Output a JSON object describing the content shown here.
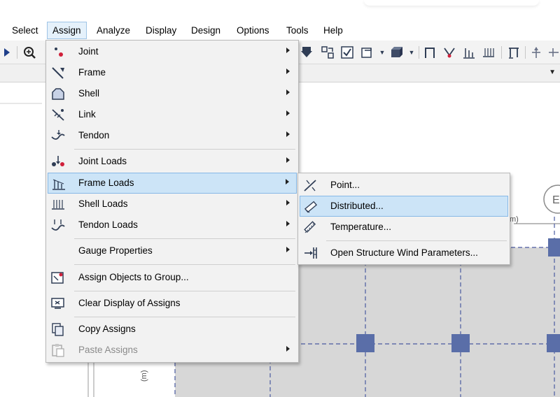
{
  "menubar": {
    "items": [
      "Select",
      "Assign",
      "Analyze",
      "Display",
      "Design",
      "Options",
      "Tools",
      "Help"
    ],
    "active": "Assign"
  },
  "assign_menu": {
    "items": [
      {
        "label": "Joint",
        "icon": "joint-icon",
        "submenu": true
      },
      {
        "label": "Frame",
        "icon": "frame-icon",
        "submenu": true
      },
      {
        "label": "Shell",
        "icon": "shell-icon",
        "submenu": true
      },
      {
        "label": "Link",
        "icon": "link-icon",
        "submenu": true
      },
      {
        "label": "Tendon",
        "icon": "tendon-icon",
        "submenu": true
      },
      {
        "label": "Joint Loads",
        "icon": "joint-loads-icon",
        "submenu": true
      },
      {
        "label": "Frame Loads",
        "icon": "frame-loads-icon",
        "submenu": true,
        "highlighted": true
      },
      {
        "label": "Shell Loads",
        "icon": "shell-loads-icon",
        "submenu": true
      },
      {
        "label": "Tendon Loads",
        "icon": "tendon-loads-icon",
        "submenu": true
      },
      {
        "label": "Gauge Properties",
        "icon": "",
        "submenu": true
      },
      {
        "label": "Assign Objects to Group...",
        "icon": "group-icon",
        "submenu": false
      },
      {
        "label": "Clear Display of Assigns",
        "icon": "clear-display-icon",
        "submenu": false
      },
      {
        "label": "Copy Assigns",
        "icon": "copy-icon",
        "submenu": false
      },
      {
        "label": "Paste Assigns",
        "icon": "paste-icon",
        "submenu": true,
        "disabled": true
      }
    ]
  },
  "frame_loads_submenu": {
    "items": [
      {
        "label": "Point...",
        "icon": "point-load-icon"
      },
      {
        "label": "Distributed...",
        "icon": "distributed-load-icon",
        "highlighted": true
      },
      {
        "label": "Temperature...",
        "icon": "temperature-icon"
      },
      {
        "label": "Open Structure Wind Parameters...",
        "icon": "wind-parameters-icon"
      }
    ]
  },
  "canvas": {
    "bubble_label": "E",
    "unit_label_top": "m)",
    "unit_label_left": "(m)"
  },
  "colors": {
    "accent": "#cce4f7",
    "highlight_border": "#86b8e6",
    "grid_node": "#5a6ea8",
    "slab_fill": "#d7d7d7",
    "grid_line": "#4a5aa0"
  }
}
